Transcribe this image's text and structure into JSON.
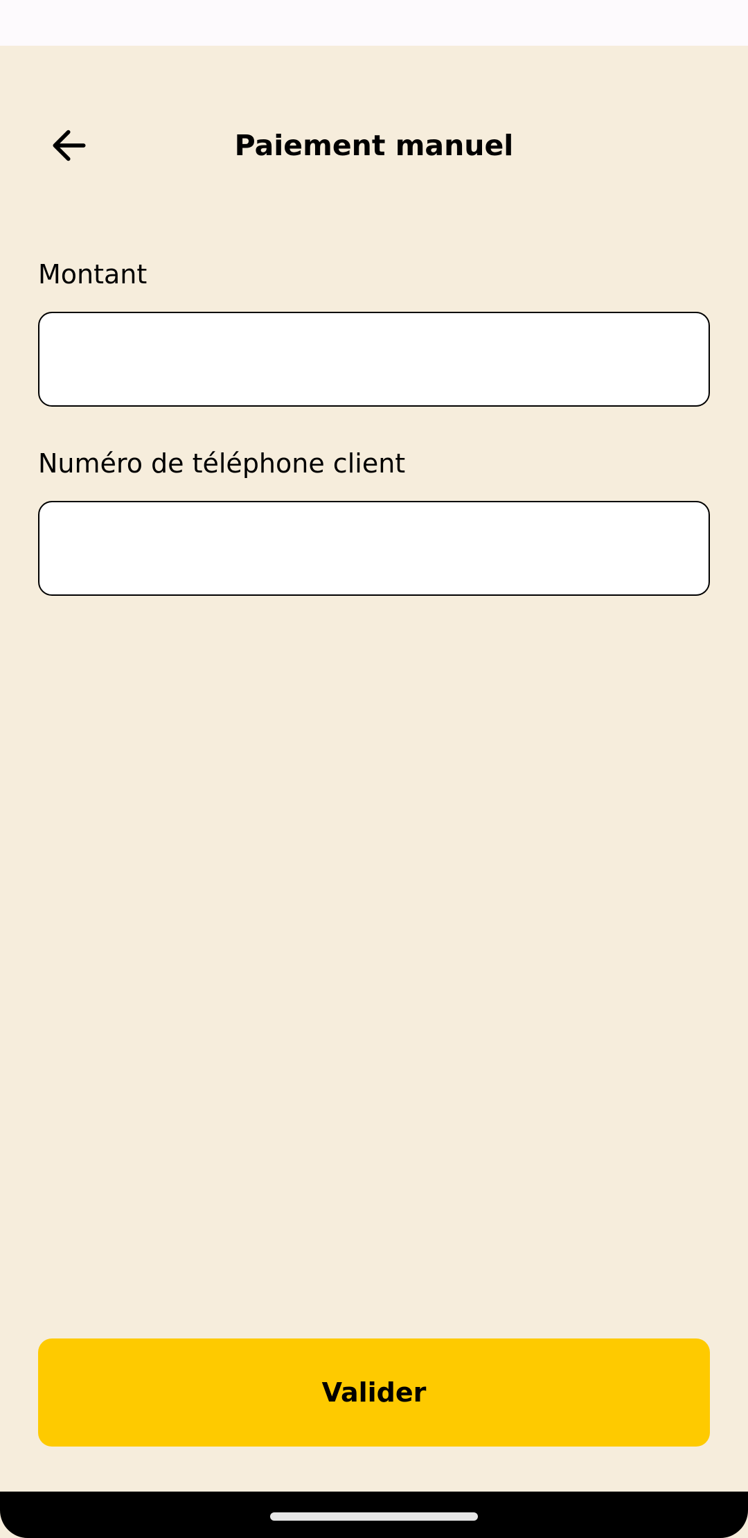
{
  "header": {
    "title": "Paiement manuel",
    "back_icon": "arrow-left-icon"
  },
  "form": {
    "amount": {
      "label": "Montant",
      "value": "",
      "placeholder": ""
    },
    "phone": {
      "label": "Numéro de téléphone client",
      "value": "",
      "placeholder": ""
    },
    "submit_label": "Valider"
  },
  "colors": {
    "background": "#F6EDDC",
    "accent": "#FECA00",
    "text": "#000000"
  }
}
